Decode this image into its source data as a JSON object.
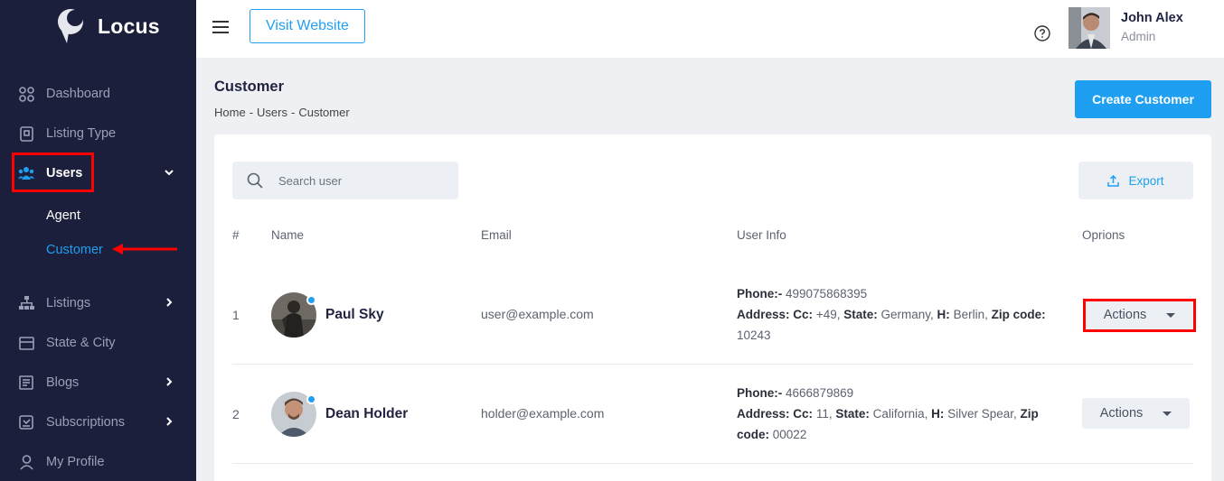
{
  "brand": {
    "name": "Locus"
  },
  "sidebar": {
    "items": [
      {
        "label": "Dashboard",
        "icon": "dashboard-icon"
      },
      {
        "label": "Listing Type",
        "icon": "listing-type-icon"
      },
      {
        "label": "Users",
        "icon": "users-icon",
        "active": true
      },
      {
        "label": "Listings",
        "icon": "sitemap-icon"
      },
      {
        "label": "State & City",
        "icon": "map-icon"
      },
      {
        "label": "Blogs",
        "icon": "blog-icon"
      },
      {
        "label": "Subscriptions",
        "icon": "subscription-icon"
      },
      {
        "label": "My Profile",
        "icon": "person-icon"
      }
    ],
    "users_submenu": [
      {
        "label": "Agent"
      },
      {
        "label": "Customer",
        "active": true
      }
    ]
  },
  "topbar": {
    "visit_label": "Visit Website",
    "user_name": "John Alex",
    "user_role": "Admin"
  },
  "page": {
    "title": "Customer",
    "breadcrumb": [
      "Home",
      "-",
      "Users",
      "-",
      "Customer"
    ],
    "create_label": "Create Customer"
  },
  "toolbar": {
    "search_placeholder": "Search user",
    "export_label": "Export"
  },
  "table": {
    "columns": [
      "#",
      "Name",
      "Email",
      "User Info",
      "Oprions"
    ],
    "rows": [
      {
        "num": "1",
        "name": "Paul Sky",
        "email": "user@example.com",
        "phone_label": "Phone:-",
        "phone": "499075868395",
        "address_label": "Address:",
        "cc_label": "Cc:",
        "cc": "+49,",
        "state_label": "State:",
        "state": "Germany,",
        "h_label": "H:",
        "h": "Berlin,",
        "zip_label": "Zip code:",
        "zip": "10243",
        "action_label": "Actions"
      },
      {
        "num": "2",
        "name": "Dean Holder",
        "email": "holder@example.com",
        "phone_label": "Phone:-",
        "phone": "4666879869",
        "address_label": "Address:",
        "cc_label": "Cc:",
        "cc": "11,",
        "state_label": "State:",
        "state": "California,",
        "h_label": "H:",
        "h": "Silver Spear,",
        "zip_label": "Zip code:",
        "zip": "00022",
        "action_label": "Actions"
      }
    ]
  },
  "colors": {
    "sidebar_bg": "#1c1f3b",
    "accent": "#1e9ff2",
    "highlight": "#ff0000"
  }
}
